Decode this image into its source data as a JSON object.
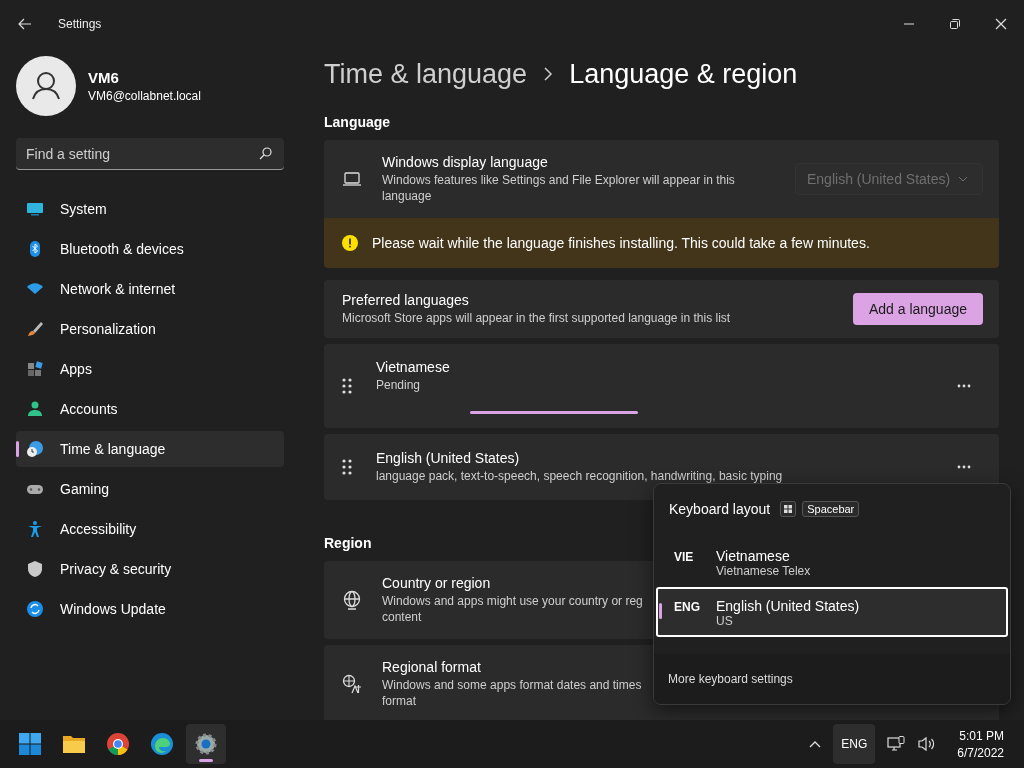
{
  "window": {
    "title": "Settings"
  },
  "user": {
    "name": "VM6",
    "email": "VM6@collabnet.local"
  },
  "search": {
    "placeholder": "Find a setting"
  },
  "nav": [
    {
      "label": "System",
      "selected": false
    },
    {
      "label": "Bluetooth & devices",
      "selected": false
    },
    {
      "label": "Network & internet",
      "selected": false
    },
    {
      "label": "Personalization",
      "selected": false
    },
    {
      "label": "Apps",
      "selected": false
    },
    {
      "label": "Accounts",
      "selected": false
    },
    {
      "label": "Time & language",
      "selected": true
    },
    {
      "label": "Gaming",
      "selected": false
    },
    {
      "label": "Accessibility",
      "selected": false
    },
    {
      "label": "Privacy & security",
      "selected": false
    },
    {
      "label": "Windows Update",
      "selected": false
    }
  ],
  "breadcrumb": [
    "Time & language",
    "Language & region"
  ],
  "language_section": {
    "heading": "Language",
    "display": {
      "title": "Windows display language",
      "description": "Windows features like Settings and File Explorer will appear in this language",
      "dropdown": {
        "value": "English (United States)",
        "disabled": true
      }
    },
    "warning": "Please wait while the language finishes installing. This could take a few minutes.",
    "preferred": {
      "title": "Preferred languages",
      "description": "Microsoft Store apps will appear in the first supported language in this list",
      "button": "Add a language"
    },
    "languages": [
      {
        "name": "Vietnamese",
        "detail": "Pending",
        "installing": true
      },
      {
        "name": "English (United States)",
        "detail": "language pack, text-to-speech, speech recognition, handwriting, basic typing",
        "installing": false
      }
    ]
  },
  "region_section": {
    "heading": "Region",
    "items": [
      {
        "title": "Country or region",
        "description_lines": [
          "Windows and apps might use your country or reg",
          "content"
        ]
      },
      {
        "title": "Regional format",
        "description_lines": [
          "Windows and some apps format dates and times",
          "format"
        ]
      }
    ]
  },
  "keyboard_flyout": {
    "title": "Keyboard layout",
    "shortcut": "Spacebar",
    "layouts": [
      {
        "code": "VIE",
        "name": "Vietnamese",
        "layout": "Vietnamese Telex",
        "selected": false
      },
      {
        "code": "ENG",
        "name": "English (United States)",
        "layout": "US",
        "selected": true
      }
    ],
    "footer": "More keyboard settings"
  },
  "taskbar": {
    "apps": [
      {
        "selected": false
      },
      {
        "selected": false
      },
      {
        "selected": false
      },
      {
        "selected": false
      },
      {
        "selected": true
      }
    ],
    "input_indicator": "ENG",
    "time": "5:01 PM",
    "date": "6/7/2022"
  }
}
